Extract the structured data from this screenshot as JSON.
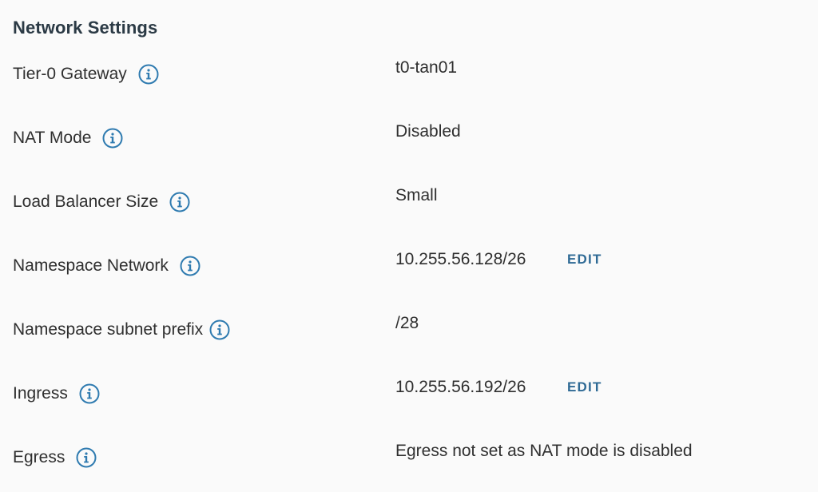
{
  "section": {
    "title": "Network Settings"
  },
  "colors": {
    "info_icon": "#2f7bb0",
    "edit_link": "#2f6a95",
    "background": "#fafafa"
  },
  "rows": [
    {
      "label": "Tier-0 Gateway",
      "icon": "info-icon",
      "value": "t0-tan01"
    },
    {
      "label": "NAT Mode",
      "icon": "info-icon",
      "value": "Disabled"
    },
    {
      "label": "Load Balancer Size",
      "icon": "info-icon",
      "value": "Small"
    },
    {
      "label": "Namespace Network",
      "icon": "info-icon",
      "value": "10.255.56.128/26",
      "action": "EDIT"
    },
    {
      "label": "Namespace subnet prefix",
      "icon": "info-icon",
      "value": "/28"
    },
    {
      "label": "Ingress",
      "icon": "info-icon",
      "value": "10.255.56.192/26",
      "action": "EDIT"
    },
    {
      "label": "Egress",
      "icon": "info-icon",
      "value": "Egress not set as NAT mode is disabled"
    }
  ]
}
